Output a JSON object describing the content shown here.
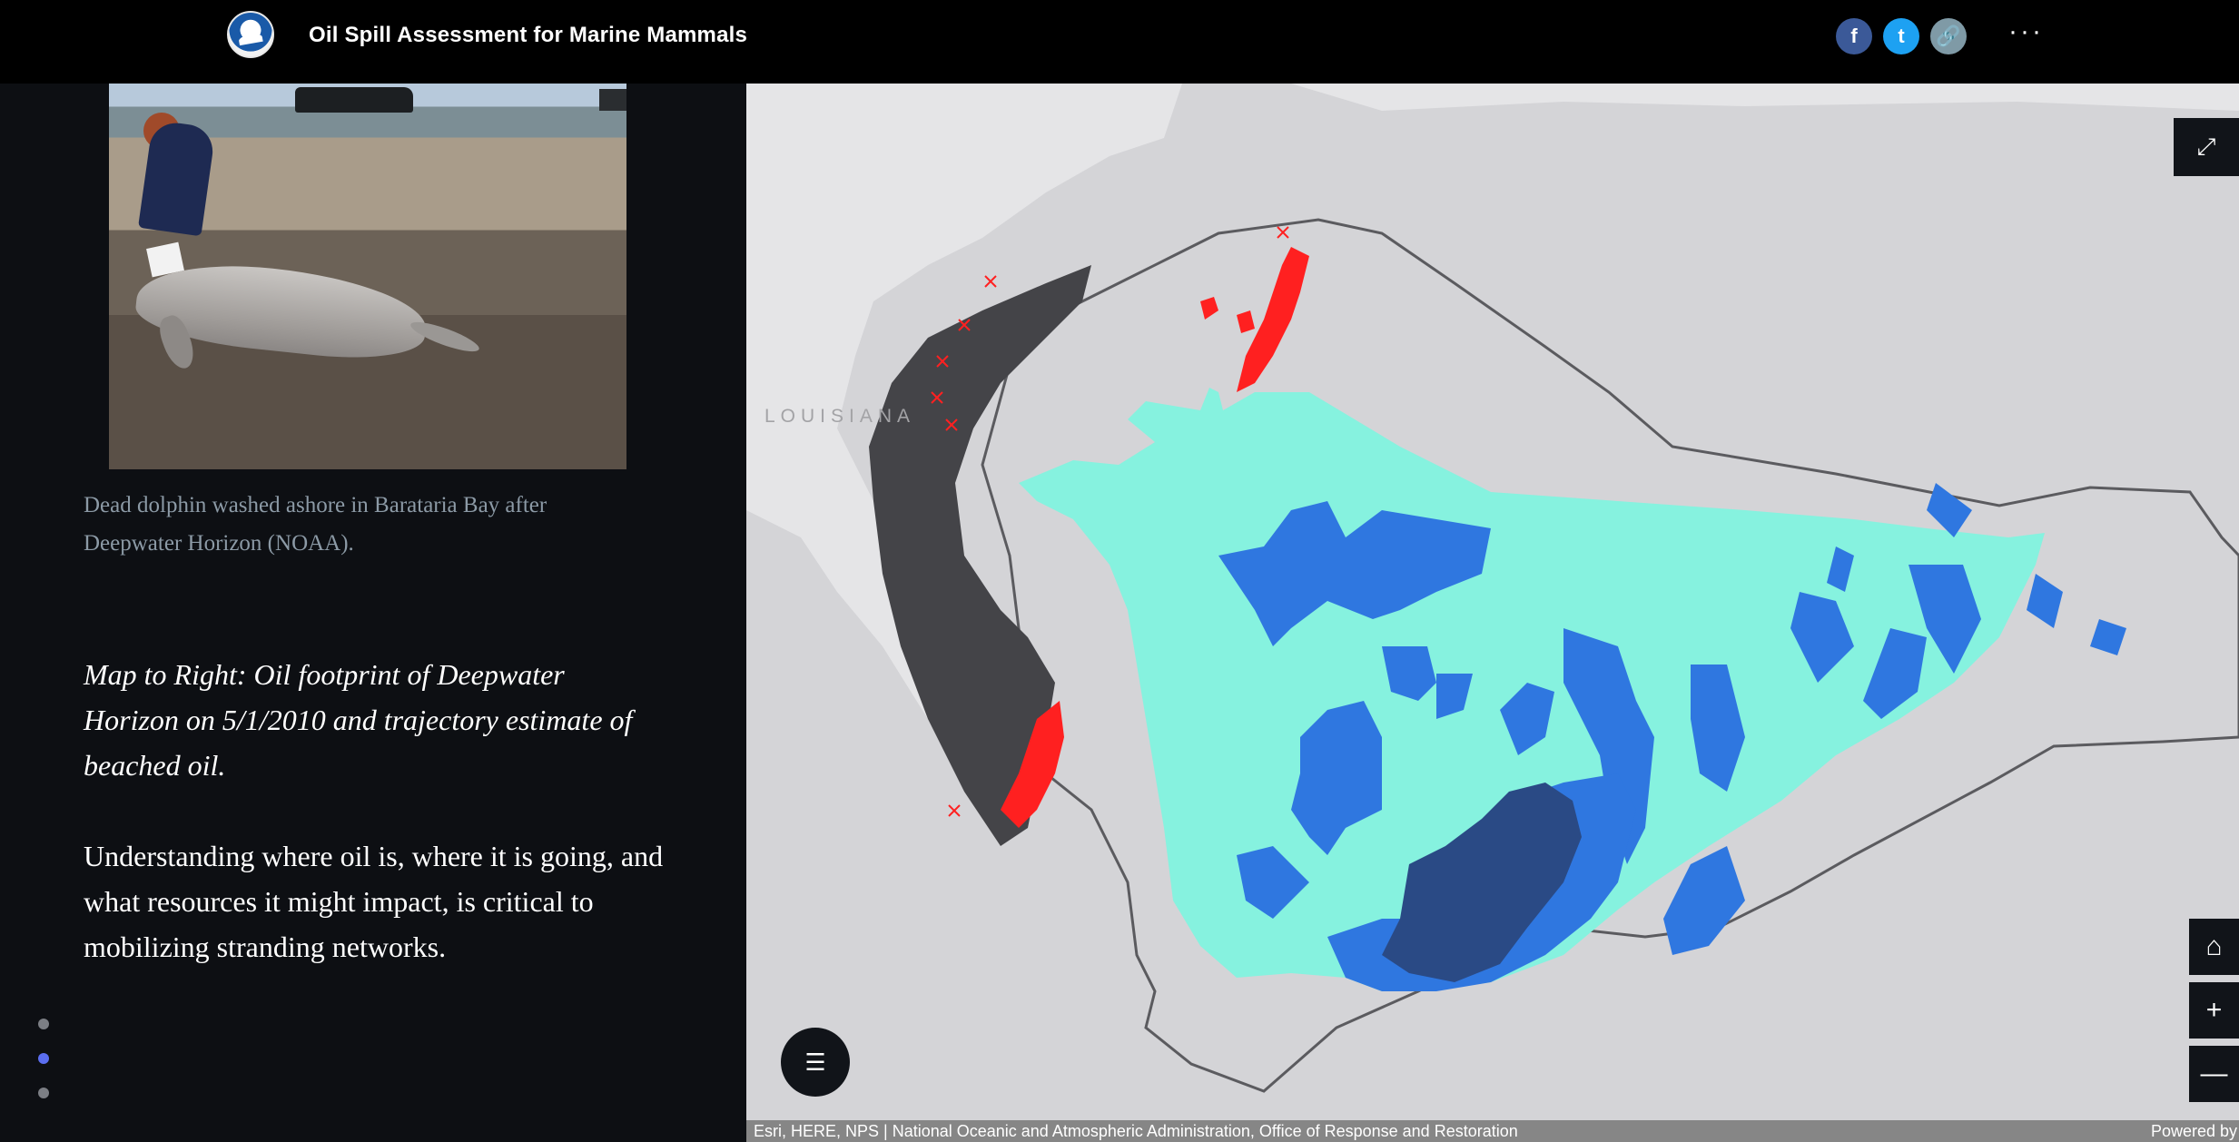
{
  "header": {
    "title": "Oil Spill Assessment for Marine Mammals",
    "share": {
      "facebook_icon": "f",
      "twitter_icon": "t",
      "link_icon": "🔗"
    },
    "more_label": "···"
  },
  "left": {
    "photo_alt": "Dead dolphin on beach",
    "caption": "Dead dolphin washed ashore in Barataria Bay after Deepwater Horizon (NOAA).",
    "heading": "Map to Right: Oil footprint of Deepwater Horizon on 5/1/2010 and trajectory estimate of beached oil.",
    "paragraph": "Understanding where oil is, where it is going, and what resources it might impact, is critical to mobilizing stranding networks.",
    "nav_dots": [
      {
        "active": false
      },
      {
        "active": true
      },
      {
        "active": false
      }
    ]
  },
  "map": {
    "label_louisiana": "LOUISIANA",
    "attribution": "Esri, HERE, NPS | National Oceanic and Atmospheric Administration, Office of Response and Restoration",
    "powered_by": "Powered by",
    "colors": {
      "water": "#d4d4d7",
      "land": "#e5e5e7",
      "coast": "#444448",
      "oil_light": "#86f2df",
      "oil_medium": "#2f77e0",
      "oil_heavy": "#2a4a85",
      "beached_oil": "#ff2020",
      "boundary": "#5b5b5f"
    },
    "controls": {
      "expand": "⤢",
      "legend": "☰",
      "home": "⌂",
      "zoom_in": "+",
      "zoom_out": "—"
    }
  }
}
